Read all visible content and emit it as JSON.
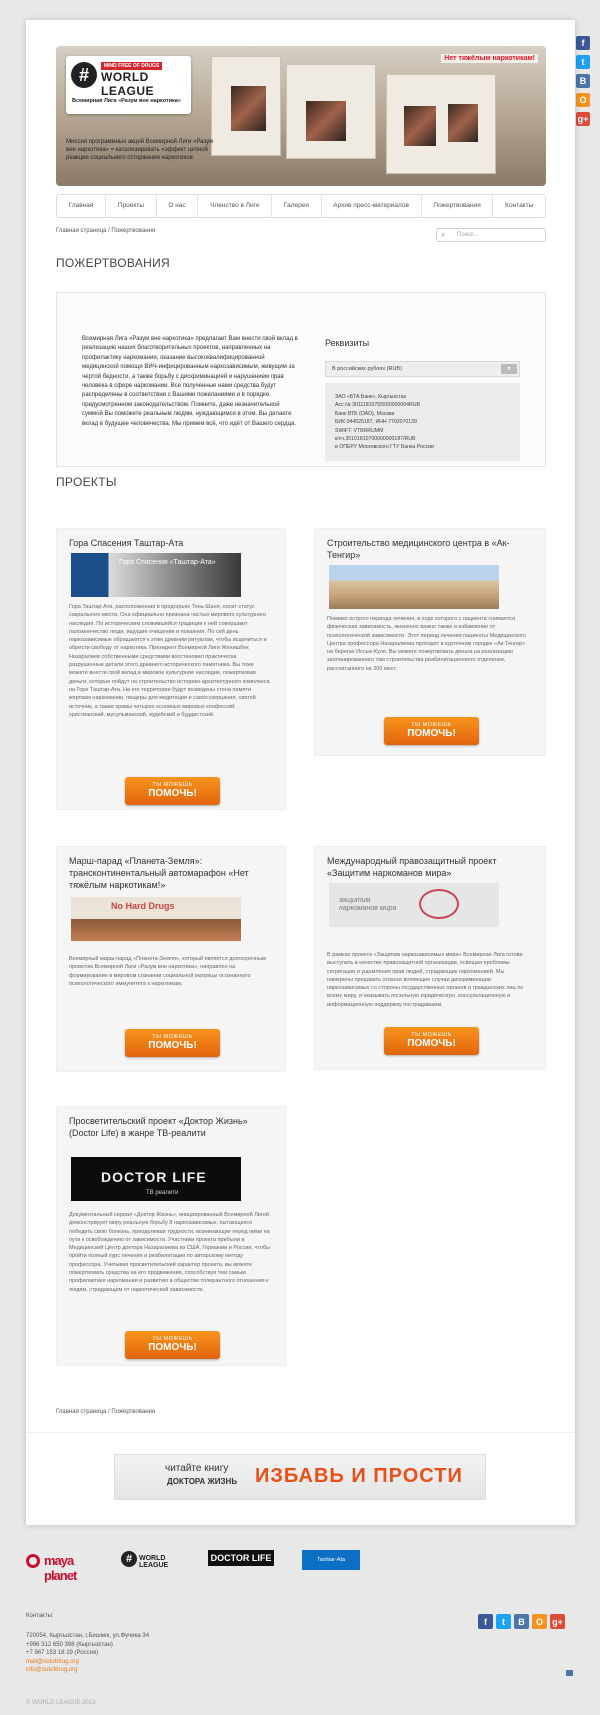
{
  "languages": [
    {
      "code": "en",
      "icon": "flag-en"
    },
    {
      "code": "ru",
      "icon": "flag-ru"
    }
  ],
  "social": [
    {
      "letter": "f",
      "color": "#3b5998",
      "icon": "facebook-icon"
    },
    {
      "letter": "t",
      "color": "#1da1f2",
      "icon": "twitter-icon"
    },
    {
      "letter": "B",
      "color": "#4a76a8",
      "icon": "vk-icon"
    },
    {
      "letter": "O",
      "color": "#f7931e",
      "icon": "odnoklassniki-icon"
    },
    {
      "letter": "g+",
      "color": "#dd4b39",
      "icon": "google-plus-icon"
    }
  ],
  "header": {
    "mind_free": "MIND FREE OF DRUGS",
    "logo_text": "WORLD LEAGUE",
    "league_name": "Всемирная Лига «Разум вне наркотика»",
    "tagline": "Нет тяжёлым наркотикам!",
    "mission": "Миссия программных акций Всемирной Лиги «Разум вне наркотика» = катализировать «эффект цепной реакции социального отторжения наркотиков"
  },
  "nav": [
    "Главная",
    "Проекты",
    "О нас",
    "Членство в Лиге",
    "Галерея",
    "Архив пресс-материалов",
    "Пожертвования",
    "Контакты"
  ],
  "breadcrumbs": {
    "home": "Главная страница",
    "sep": "/",
    "current": "Пожертвования"
  },
  "search": {
    "placeholder": "Поиск..."
  },
  "page_title": "ПОЖЕРТВОВАНИЯ",
  "donation": {
    "text": "Всемирная Лига «Разум вне наркотика» предлагает Вам внести свой вклад в реализацию наших благотворительных проектов, направленных на профилактику наркомании, оказание высококвалифицированной медицинской помощи ВИЧ-инфицированным наркозависимым, живущим за чертой бедности, а также борьбу с дискриминацией и нарушением прав человека в сфере наркомании. Все полученные нами средства будут распределены в соответствии с Вашими пожеланиями и в порядке, предусмотренном законодательством. Помните, даже незначительной суммой Вы поможете реальным людям, нуждающимся в этом. Вы делаете вклад в будущее человечества. Мы примем всё, что идёт от Вашего сердца.",
    "requisites_title": "Реквизиты",
    "currency_selected": "В российских рублях (RUB)",
    "bank_lines": [
      "ЗАО «БТА Банк», Кыргызстан",
      "Acc.№ 30111810755550000004RUB",
      "Банк ВТБ (ОАО), Москва",
      "БИК 044525187, ИНН 7702070139",
      "SWIFT: VTBRRUMM",
      "к/сч.30101810700000000187/RUB",
      "в ОПЕРУ Московского ГТУ Банка России"
    ]
  },
  "projects_title": "ПРОЕКТЫ",
  "projects": [
    {
      "title": "Гора Спасения Таштар-Ата",
      "desc": "Гора Таштар-Ата, расположенная в предгорьях Тянь-Шаня, носит статус сакрального места. Она официально признана частью мирового культурного наследия. По историческим сложившейся традиции к ней совершают паломничество люди, ищущие очищения и покаяния. По сей день наркозависимые обращаются к этим древним ритуалам, чтобы исцелиться и обрести свободу от наркотика. Президент Всемирной Лиги Женишбек Назаралиев собственными средствами восстановил практически разрушенные детали этого древнего исторического памятника. Вы тоже можете внести свой вклад в мировое культурное наследие, пожертвовав деньги, которые пойдут на строительство историко-архитектурного комплекса на Горе Таштар-Ата. На его территории будут возведены стена памяти жертвам наркомании, пещеры для медитации и самосозерцания, святой источник, а также храмы четырех основных мировых конфессий: христианский, мусульманский, иудейский и буддистский.",
      "img_text": "Гора Спасения «Таштар-Ата»"
    },
    {
      "title": "Строительство медицинского центра в «Ак-Тенгир»",
      "desc": "Помимо острого периода лечения, в ходе которого с пациента снимается физическая зависимость, жизненно важно также и избавление от психологической зависимости. Этот период лечения пациенты Медицинского Центра профессора Назаралиева проходят в курточном городке «Ак-Тенгир» на берегах Иссык-Куля. Вы можете пожертвовать деньги на реализацию запланированного там строительства реабилитационного отделения, рассчитанного на 200 мест.",
      "img_text": ""
    },
    {
      "title": "Марш-парад «Планета-Земля»: трансконтинентальный автомарафон «Нет тяжёлым наркотикам!»",
      "desc": "Всемирный марш-парад «Планета-Земля», который является долгосрочным проектом Всемирной Лиги «Разум вне наркотика», направлен на формирование в мировом сознании социальной матрицы осознанного психологического иммунитета к наркотикам.",
      "img_text": "No Hard Drugs"
    },
    {
      "title": "Международный правозащитный проект «Защитим наркоманов мира»",
      "desc": "В рамках проекта «Защитим наркозависимых мира» Всемирная Лига готова выступать в качестве правозащитной организации, освещая проблемы сегрегации и ущемления прав людей, страдающих наркоманией. Мы намерены предавать огласке вопиющие случаи дискриминации наркозависимых со стороны государственных органов и гражданских лиц по всему миру, и оказывать посильную юридическую, консультационную и информационную поддержку пострадавшим.",
      "img_text": "защитим наркоманов мира"
    },
    {
      "title": "Просветительский проект «Доктор Жизнь» (Doctor Life) в жанре ТВ-реалити",
      "desc": "Документальный сериал «Доктор Жизнь», инициированный Всемирной Лигой, демонстрирует миру реальную борьбу 8 наркозависимых, пытающихся победить свою болезнь, преодолевая трудности, возникающие перед ними на пути к освобождению от зависимости. Участники проекта прибыли в Медицинский Центр доктора Назаралиева из США, Германии и России, чтобы пройти полный курс лечения и реабилитации по авторскому методу профессора. Учитывая просветительский характер проекта, вы можете пожертвовать средства на его продвижение, способствуя тем самым профилактике наркомании и развитию в обществе толерантного отношения к людям, страдающим от наркотической зависимости.",
      "img_text": "DOCTOR LIFE",
      "img_sub": "ТВ реалити"
    }
  ],
  "donate_btn": {
    "small": "ТЫ МОЖЕШЬ",
    "big": "ПОМОЧЬ!"
  },
  "book": {
    "line1": "читайте книгу",
    "line2": "ДОКТОРА ЖИЗНЬ",
    "title": "ИЗБАВЬ И ПРОСТИ"
  },
  "partners": [
    "maya planet",
    "WORLD LEAGUE",
    "DOCTOR LIFE",
    "Tashtar-Ata"
  ],
  "contacts": {
    "title": "Контакты:",
    "lines": [
      "720054, Кыргызстан, г.Бишкек, ул.Фучика 34",
      "+996 312 650 398 (Кыргызстан)",
      "+7 967 153 18 29 (Россия)"
    ],
    "emails": [
      "mail@outofdrug.org",
      "info@outofdrug.org"
    ]
  },
  "copyright": "© WORLD LEAGUE 2013"
}
